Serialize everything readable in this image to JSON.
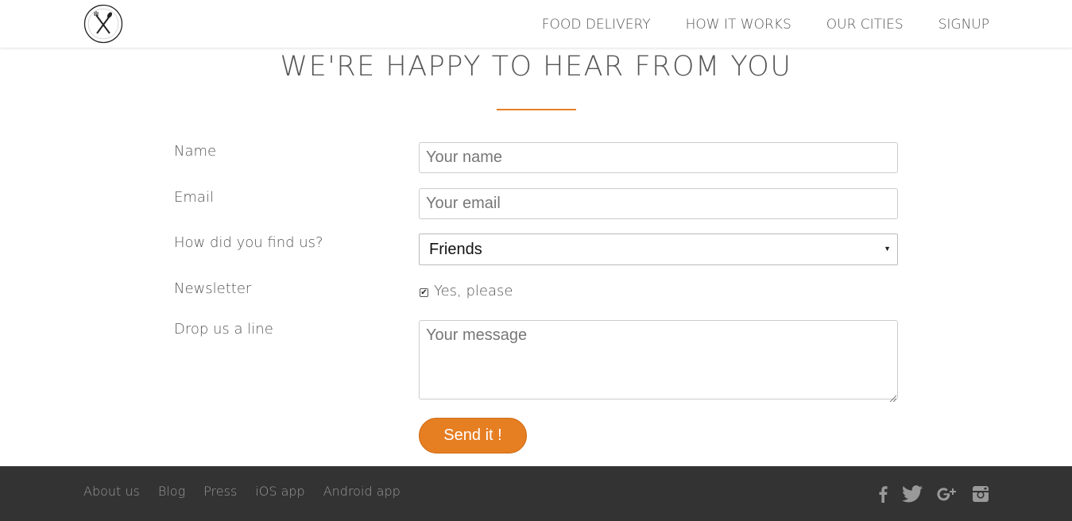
{
  "header": {
    "logo_icon": "fork-spoon-logo-icon",
    "nav": [
      {
        "label": "FOOD DELIVERY"
      },
      {
        "label": "HOW IT WORKS"
      },
      {
        "label": "OUR CITIES"
      },
      {
        "label": "SIGNUP"
      }
    ]
  },
  "main": {
    "title": "WE'RE HAPPY TO HEAR FROM YOU",
    "accent_color": "#e67e22",
    "form": {
      "name_label": "Name",
      "name_placeholder": "Your name",
      "email_label": "Email",
      "email_placeholder": "Your email",
      "find_label": "How did you find us?",
      "find_selected": "Friends",
      "newsletter_label": "Newsletter",
      "newsletter_checked": true,
      "newsletter_option": "Yes, please",
      "message_label": "Drop us a line",
      "message_placeholder": "Your message",
      "send_label": "Send it !"
    }
  },
  "footer": {
    "links": [
      {
        "label": "About us"
      },
      {
        "label": "Blog"
      },
      {
        "label": "Press"
      },
      {
        "label": "iOS app"
      },
      {
        "label": "Android app"
      }
    ],
    "social_icons": [
      "facebook-icon",
      "twitter-icon",
      "google-plus-icon",
      "instagram-icon"
    ],
    "background_color": "#333333"
  }
}
